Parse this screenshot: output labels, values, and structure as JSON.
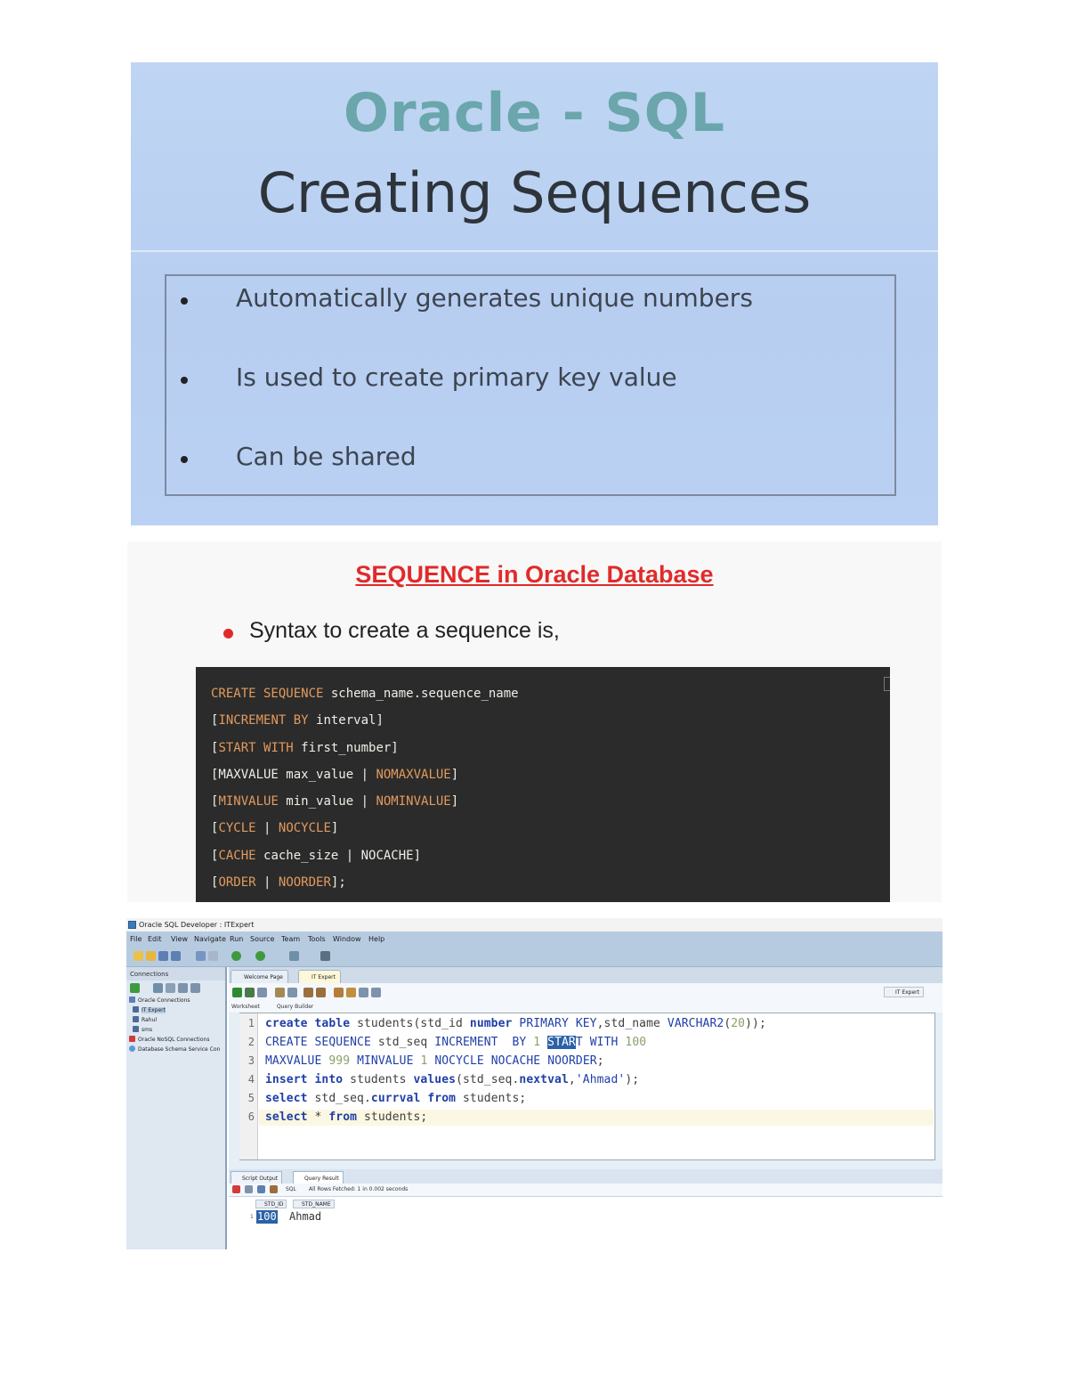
{
  "slide1": {
    "title": "Oracle - SQL",
    "subtitle": "Creating Sequences",
    "bullets": [
      "Automatically generates unique numbers",
      "Is used to create primary key value",
      "Can be shared"
    ]
  },
  "slide2": {
    "title": "SEQUENCE in Oracle Database",
    "bullet": "Syntax to create a sequence is,",
    "code_lines": [
      [
        [
          "kw",
          "CREATE SEQUENCE"
        ],
        [
          "tx",
          " schema_name.sequence_name"
        ]
      ],
      [
        [
          "tx",
          "["
        ],
        [
          "kw",
          "INCREMENT BY"
        ],
        [
          "tx",
          " interval]"
        ]
      ],
      [
        [
          "tx",
          "["
        ],
        [
          "kw",
          "START WITH"
        ],
        [
          "tx",
          " first_number]"
        ]
      ],
      [
        [
          "tx",
          "[MAXVALUE max_value | "
        ],
        [
          "kw",
          "NOMAXVALUE"
        ],
        [
          "tx",
          "]"
        ]
      ],
      [
        [
          "tx",
          "["
        ],
        [
          "kw",
          "MINVALUE"
        ],
        [
          "tx",
          " min_value | "
        ],
        [
          "kw",
          "NOMINVALUE"
        ],
        [
          "tx",
          "]"
        ]
      ],
      [
        [
          "tx",
          "["
        ],
        [
          "kw",
          "CYCLE"
        ],
        [
          "tx",
          " | "
        ],
        [
          "kw",
          "NOCYCLE"
        ],
        [
          "tx",
          "]"
        ]
      ],
      [
        [
          "tx",
          "["
        ],
        [
          "kw",
          "CACHE"
        ],
        [
          "tx",
          " cache_size | NOCACHE]"
        ]
      ],
      [
        [
          "tx",
          "["
        ],
        [
          "kw",
          "ORDER"
        ],
        [
          "tx",
          " | "
        ],
        [
          "kw",
          "NOORDER"
        ],
        [
          "tx",
          "];"
        ]
      ]
    ]
  },
  "ide": {
    "window_title": "Oracle SQL Developer : ITExpert",
    "menu": [
      "File",
      "Edit",
      "View",
      "Navigate",
      "Run",
      "Source",
      "Team",
      "Tools",
      "Window",
      "Help"
    ],
    "connections_title": "Connections",
    "tree": [
      "Oracle Connections",
      "IT Expert",
      "Rahul",
      "sms",
      "Oracle NoSQL Connections",
      "Database Schema Service Con"
    ],
    "tabs": [
      "Welcome Page",
      "IT Expert"
    ],
    "connection_select": "IT Expert",
    "subtabs": [
      "Worksheet",
      "Query Builder"
    ],
    "line_numbers": [
      "1",
      "2",
      "3",
      "4",
      "5",
      "6"
    ],
    "result_tabs": [
      "Script Output",
      "Query Result"
    ],
    "result_sql_label": "SQL",
    "result_status": "All Rows Fetched: 1 in 0.002 seconds",
    "columns": [
      "STD_ID",
      "STD_NAME"
    ],
    "row_number": "1",
    "row": [
      "100",
      "Ahmad"
    ]
  }
}
